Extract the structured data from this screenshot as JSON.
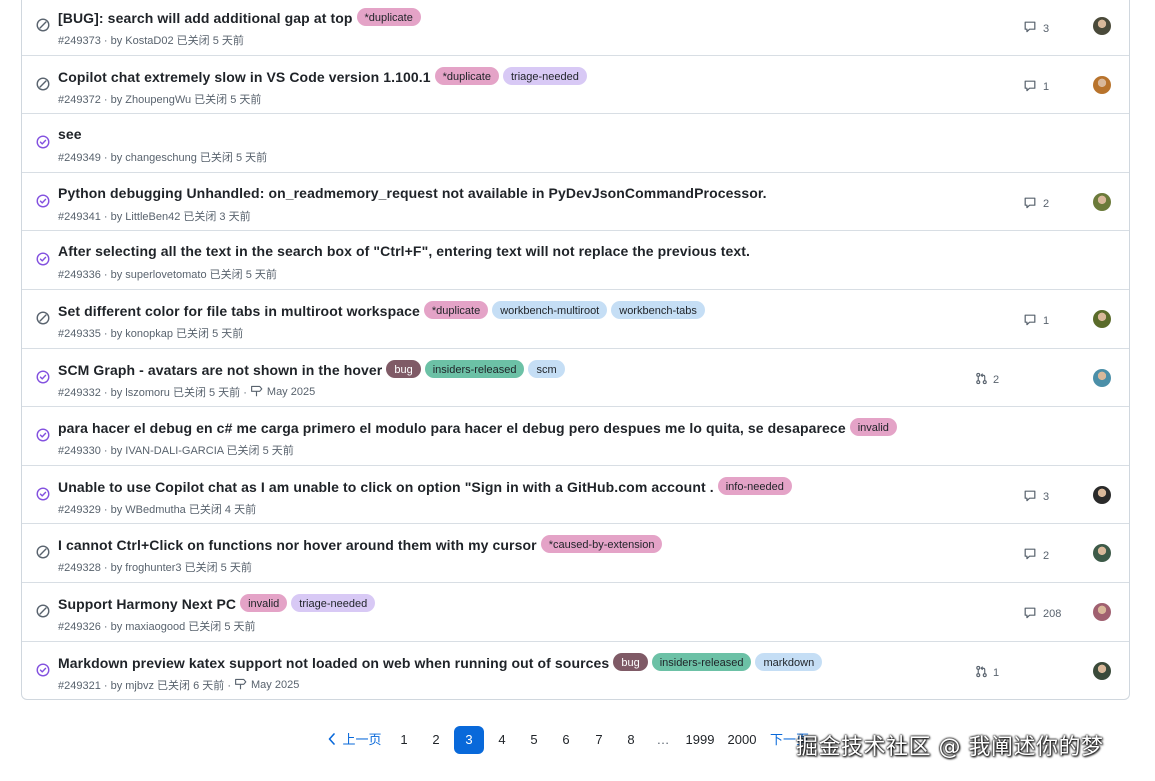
{
  "colors": {
    "closed_completed": "#8250df",
    "closed_not_planned": "#59636e",
    "link": "#0969da"
  },
  "issues": [
    {
      "state": "not_planned",
      "title": "[BUG]: search will add additional gap at top",
      "labels": [
        {
          "name": "*duplicate",
          "bg": "#e4a3c7",
          "fg": "#1f2328"
        }
      ],
      "meta": "#249373 · by KostaD02 已关闭 5 天前",
      "comments": "3",
      "avatar": "#4a4a3a"
    },
    {
      "state": "not_planned",
      "title": "Copilot chat extremely slow in VS Code version 1.100.1",
      "labels": [
        {
          "name": "*duplicate",
          "bg": "#e4a3c7",
          "fg": "#1f2328"
        },
        {
          "name": "triage-needed",
          "bg": "#d8c9f5",
          "fg": "#1f2328"
        }
      ],
      "meta": "#249372 · by ZhoupengWu 已关闭 5 天前",
      "comments": "1",
      "avatar": "#b8732c"
    },
    {
      "state": "completed",
      "title": "see",
      "labels": [],
      "meta": "#249349 · by changeschung 已关闭 5 天前"
    },
    {
      "state": "completed",
      "title": "Python debugging Unhandled: on_readmemory_request not available in PyDevJsonCommandProcessor.",
      "labels": [],
      "meta": "#249341 · by LittleBen42 已关闭 3 天前",
      "comments": "2",
      "avatar": "#6b7a3a"
    },
    {
      "state": "completed",
      "title": "After selecting all the text in the search box of \"Ctrl+F\", entering text will not replace the previous text.",
      "labels": [],
      "meta": "#249336 · by superlovetomato 已关闭 5 天前"
    },
    {
      "state": "not_planned",
      "title": "Set different color for file tabs in multiroot workspace",
      "labels": [
        {
          "name": "*duplicate",
          "bg": "#e4a3c7",
          "fg": "#1f2328"
        },
        {
          "name": "workbench-multiroot",
          "bg": "#c5def5",
          "fg": "#1f2328"
        },
        {
          "name": "workbench-tabs",
          "bg": "#c5def5",
          "fg": "#1f2328"
        }
      ],
      "meta": "#249335 · by konopkap 已关闭 5 天前",
      "comments": "1",
      "avatar": "#5a6b2a"
    },
    {
      "state": "completed",
      "title": "SCM Graph - avatars are not shown in the hover",
      "labels": [
        {
          "name": "bug",
          "bg": "#7f5a66",
          "fg": "#ffffff"
        },
        {
          "name": "insiders-released",
          "bg": "#6cc1a6",
          "fg": "#1f2328"
        },
        {
          "name": "scm",
          "bg": "#c5def5",
          "fg": "#1f2328"
        }
      ],
      "meta": "#249332 · by lszomoru 已关闭 5 天前 ·",
      "milestone": "May 2025",
      "linked": "2",
      "avatar": "#4b8fa8"
    },
    {
      "state": "completed",
      "title": "para hacer el debug en c# me carga primero el modulo para hacer el debug pero despues me lo quita, se desaparece",
      "labels": [
        {
          "name": "invalid",
          "bg": "#e4a3c7",
          "fg": "#1f2328"
        }
      ],
      "meta": "#249330 · by IVAN-DALI-GARCIA 已关闭 5 天前"
    },
    {
      "state": "completed",
      "title": "Unable to use Copilot chat as I am unable to click on option \"Sign in with a GitHub.com account .",
      "labels": [
        {
          "name": "info-needed",
          "bg": "#e4a3c7",
          "fg": "#1f2328"
        }
      ],
      "meta": "#249329 · by WBedmutha 已关闭 4 天前",
      "comments": "3",
      "avatar": "#2a2a2a"
    },
    {
      "state": "not_planned",
      "title": "I cannot Ctrl+Click on functions nor hover around them with my cursor",
      "labels": [
        {
          "name": "*caused-by-extension",
          "bg": "#e4a3c7",
          "fg": "#1f2328"
        }
      ],
      "meta": "#249328 · by froghunter3 已关闭 5 天前",
      "comments": "2",
      "avatar": "#3d5a48"
    },
    {
      "state": "not_planned",
      "title": "Support Harmony Next PC",
      "labels": [
        {
          "name": "invalid",
          "bg": "#e4a3c7",
          "fg": "#1f2328"
        },
        {
          "name": "triage-needed",
          "bg": "#d8c9f5",
          "fg": "#1f2328"
        }
      ],
      "meta": "#249326 · by maxiaogood 已关闭 5 天前",
      "comments": "208",
      "avatar": "#a06070"
    },
    {
      "state": "completed",
      "title": "Markdown preview katex support not loaded on web when running out of sources",
      "labels": [
        {
          "name": "bug",
          "bg": "#7f5a66",
          "fg": "#ffffff"
        },
        {
          "name": "insiders-released",
          "bg": "#6cc1a6",
          "fg": "#1f2328"
        },
        {
          "name": "markdown",
          "bg": "#c5def5",
          "fg": "#1f2328"
        }
      ],
      "meta": "#249321 · by mjbvz 已关闭 6 天前 ·",
      "milestone": "May 2025",
      "linked": "1",
      "avatar": "#3a4a3a"
    }
  ],
  "pagination": {
    "prev_label": "上一页",
    "next_label": "下一页",
    "pages": [
      "1",
      "2",
      "3",
      "4",
      "5",
      "6",
      "7",
      "8",
      "…",
      "1999",
      "2000"
    ],
    "current": "3"
  },
  "watermark": "掘金技术社区 @ 我阐述你的梦"
}
